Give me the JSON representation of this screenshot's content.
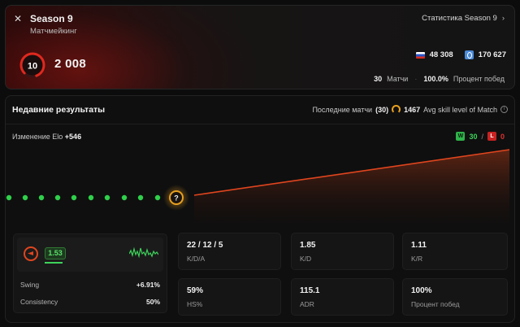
{
  "season": {
    "title": "Season 9",
    "subtitle": "Матчмейкинг",
    "link_label": "Статистика Season 9",
    "level": "10",
    "elo": "2 008",
    "rank_country": "48 308",
    "rank_global": "170 627",
    "matches_value": "30",
    "matches_label": "Матчи",
    "winrate_value": "100.0%",
    "winrate_label": "Процент побед"
  },
  "recent": {
    "title": "Недавние результаты",
    "last_matches_label": "Последние матчи",
    "last_matches_count": "(30)",
    "avg_skill_value": "1467",
    "avg_skill_label": "Avg skill level of Match",
    "elo_change_label": "Изменение Elo",
    "elo_change_value": "+546",
    "wins_letter": "W",
    "wins": "30",
    "losses_letter": "L",
    "losses": "0",
    "marker_label": "?"
  },
  "performance": {
    "rating": "1.53",
    "rating_fill": 0.85,
    "swing_label": "Swing",
    "swing_value": "+6.91%",
    "consistency_label": "Consistency",
    "consistency_value": "50%"
  },
  "stats": [
    {
      "value": "22 / 12 / 5",
      "label": "K/D/A"
    },
    {
      "value": "1.85",
      "label": "K/D"
    },
    {
      "value": "1.11",
      "label": "K/R"
    },
    {
      "value": "59%",
      "label": "HS%"
    },
    {
      "value": "115.1",
      "label": "ADR"
    },
    {
      "value": "100%",
      "label": "Процент побед"
    }
  ],
  "colors": {
    "accent_orange": "#e0451e",
    "win_green": "#2fb34a",
    "loss_red": "#c82222",
    "highlight_gold": "#e8a020"
  },
  "icons": {
    "season": "crosshair-icon",
    "link": "chevron-right-icon",
    "level": "level-ring-icon",
    "country": "russia-flag-icon",
    "global": "globe-icon",
    "avg_skill": "gauge-icon",
    "info": "info-icon",
    "performance": "target-icon"
  }
}
